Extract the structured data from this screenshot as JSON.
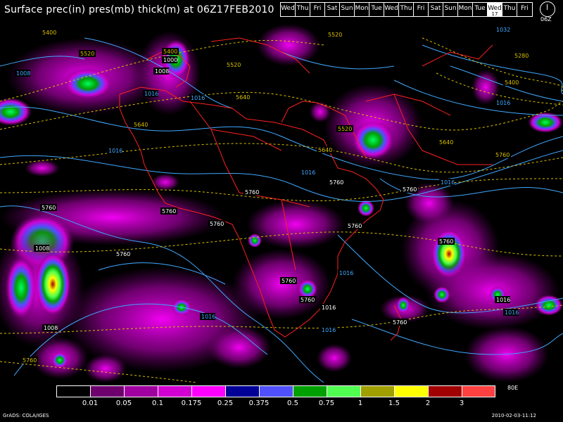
{
  "title": "Surface prec(in) pres(mb) thick(m) at 06Z17FEB2010",
  "days": [
    {
      "label": "Wed",
      "selected": false
    },
    {
      "label": "Thu",
      "selected": false
    },
    {
      "label": "Fri",
      "selected": false
    },
    {
      "label": "Sat",
      "selected": false
    },
    {
      "label": "Sun",
      "selected": false
    },
    {
      "label": "Mon",
      "selected": false
    },
    {
      "label": "Tue",
      "selected": false
    },
    {
      "label": "Wed",
      "selected": false
    },
    {
      "label": "Thu",
      "selected": false
    },
    {
      "label": "Fri",
      "selected": false
    },
    {
      "label": "Sat",
      "selected": false
    },
    {
      "label": "Sun",
      "selected": false
    },
    {
      "label": "Mon",
      "selected": false
    },
    {
      "label": "Tue",
      "selected": false
    },
    {
      "label": "Wed",
      "selected": true,
      "num": "17"
    },
    {
      "label": "Thu",
      "selected": false
    },
    {
      "label": "Fri",
      "selected": false
    }
  ],
  "clock_label": "06Z",
  "legend": {
    "colors": [
      "#000000",
      "#6e006e",
      "#a000a0",
      "#d200d2",
      "#ff00ff",
      "#000096",
      "#5050ff",
      "#00a000",
      "#50ff50",
      "#a0a000",
      "#ffff00",
      "#a00000",
      "#ff4040"
    ],
    "ticks": [
      "0.01",
      "0.05",
      "0.1",
      "0.175",
      "0.25",
      "0.375",
      "0.5",
      "0.75",
      "1",
      "1.5",
      "2",
      "3"
    ],
    "lon_label": "80E"
  },
  "footer": {
    "left": "GrADS: COLA/IGES",
    "right": "2010-02-03-11:12"
  },
  "map_labels": {
    "thickness": [
      "5400",
      "5520",
      "5400",
      "5520",
      "5640",
      "5520",
      "5640",
      "5640",
      "5520",
      "5640",
      "5400",
      "5280",
      "5760",
      "5760",
      "5760",
      "5760",
      "5760",
      "5760",
      "5760",
      "5760",
      "5760",
      "5760",
      "5760",
      "5760",
      "5760",
      "5760"
    ],
    "pressure": [
      "1008",
      "1000",
      "1008",
      "1016",
      "1016",
      "1016",
      "1016",
      "1016",
      "1016",
      "1032",
      "1008",
      "1016",
      "1016",
      "1008",
      "1016",
      "1016",
      "1016",
      "1016"
    ]
  },
  "colors": {
    "coast": "#ff2020",
    "isobar": "#40a8ff",
    "thickness": "#d8c000"
  }
}
